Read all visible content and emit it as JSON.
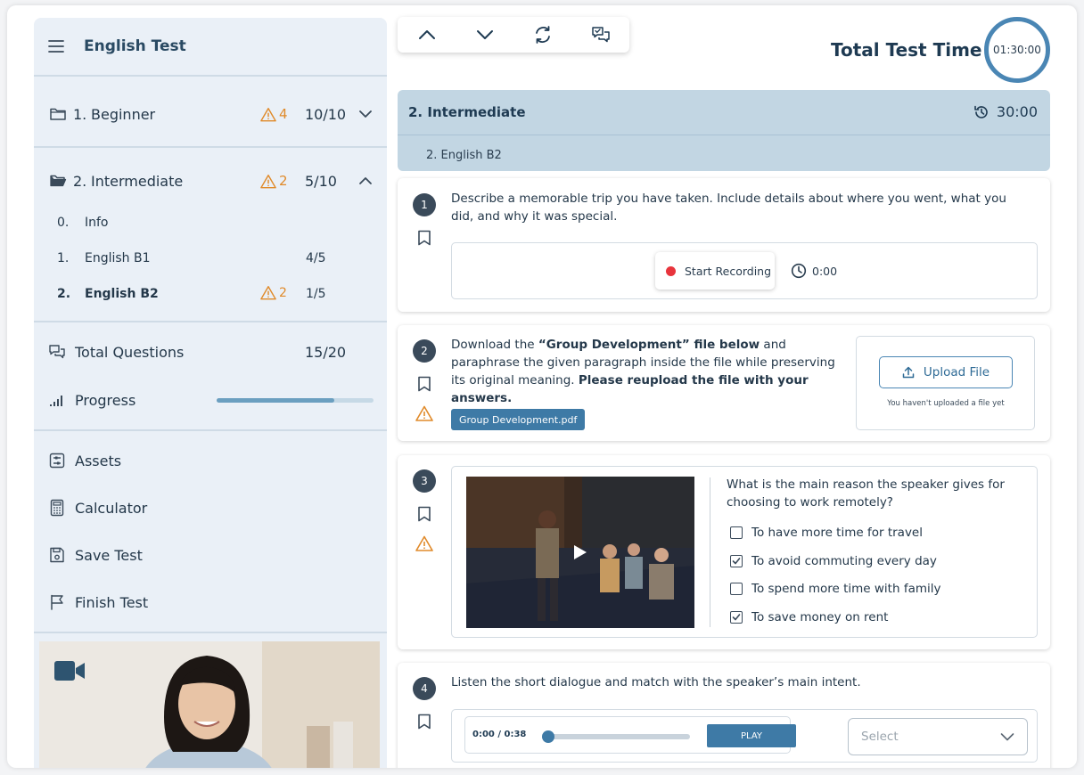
{
  "app": {
    "title": "English Test"
  },
  "sidebar": {
    "sections": [
      {
        "number": "1.",
        "label": "Beginner",
        "warnings": "4",
        "score": "10/10",
        "expanded": false
      },
      {
        "number": "2.",
        "label": "Intermediate",
        "warnings": "2",
        "score": "5/10",
        "expanded": true
      }
    ],
    "subsections": [
      {
        "number": "0.",
        "label": "Info",
        "score": "",
        "warnings": ""
      },
      {
        "number": "1.",
        "label": "English B1",
        "score": "4/5",
        "warnings": ""
      },
      {
        "number": "2.",
        "label": "English B2",
        "score": "1/5",
        "warnings": "2",
        "active": true
      }
    ],
    "total_questions": {
      "label": "Total Questions",
      "value": "15/20"
    },
    "progress": {
      "label": "Progress",
      "fraction": 0.75
    },
    "menu": [
      {
        "label": "Assets",
        "icon": "assets-icon"
      },
      {
        "label": "Calculator",
        "icon": "calculator-icon"
      },
      {
        "label": "Save Test",
        "icon": "save-icon"
      },
      {
        "label": "Finish Test",
        "icon": "flag-icon"
      }
    ]
  },
  "toolbar": {
    "buttons": [
      {
        "icon": "chevron-up-icon"
      },
      {
        "icon": "chevron-down-icon"
      },
      {
        "icon": "refresh-icon"
      },
      {
        "icon": "chat-icon"
      }
    ]
  },
  "timer": {
    "label": "Total Test Time",
    "value": "01:30:00"
  },
  "section": {
    "title": "2. Intermediate",
    "time": "30:00",
    "subtitle": "2.  English B2"
  },
  "questions": [
    {
      "number": "1",
      "text": "Describe a memorable trip you have taken. Include details about where you went, what you did, and why it was special.",
      "record_label": "Start Recording",
      "record_time": "0:00"
    },
    {
      "number": "2",
      "text_parts": [
        "Download the ",
        "“Group Development” file below",
        " and paraphrase the given paragraph inside the file while preserving its original meaning. ",
        "Please reupload the file with your answers."
      ],
      "file_label": "Group Development.pdf",
      "upload_label": "Upload File",
      "upload_note": "You haven't uploaded a file yet"
    },
    {
      "number": "3",
      "text": "What is the main reason the speaker gives for choosing to work remotely?",
      "options": [
        {
          "label": "To have more time for travel",
          "checked": false
        },
        {
          "label": "To avoid commuting every day",
          "checked": true
        },
        {
          "label": "To spend more time with family",
          "checked": false
        },
        {
          "label": "To save money on rent",
          "checked": true
        }
      ]
    },
    {
      "number": "4",
      "text": "Listen the short dialogue and match with the speaker’s main intent.",
      "audio_time": "0:00 / 0:38",
      "audio_progress": 0,
      "play_label": "PLAY",
      "select_placeholder": "Select"
    }
  ],
  "colors": {
    "accent": "#4a86b4",
    "warning": "#e08a2a",
    "record": "#e8343c",
    "sidebar_bg": "#eaf0f7",
    "section_bg": "#c2d6e3"
  }
}
